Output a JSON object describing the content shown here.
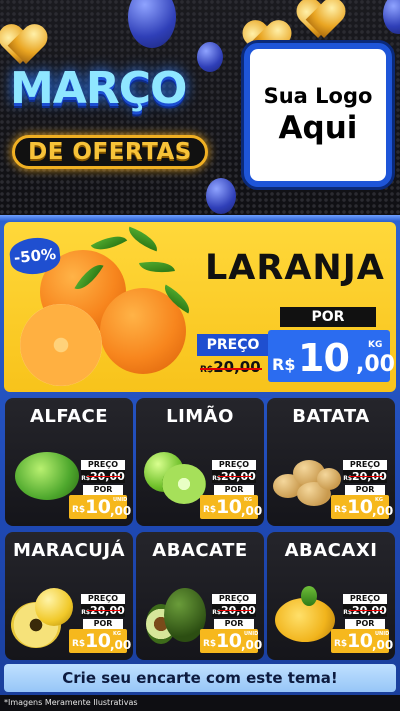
{
  "header": {
    "title_line1": "MARÇO",
    "title_line2": "DE OFERTAS",
    "logo_line1": "Sua Logo",
    "logo_line2": "Aqui"
  },
  "featured": {
    "discount": "-50%",
    "name": "LARANJA",
    "por_label": "POR",
    "preco_label": "PREÇO",
    "old_currency": "R$",
    "old_price": "20,00",
    "currency": "R$",
    "price_int": "10",
    "price_dec": ",00",
    "unit": "KG"
  },
  "products": [
    {
      "name": "ALFACE",
      "preco_label": "PREÇO",
      "old_currency": "R$",
      "old_price": "20,00",
      "por_label": "POR",
      "currency": "R$",
      "price_int": "10",
      "price_dec": ",00",
      "unit": "UNID"
    },
    {
      "name": "LIMÃO",
      "preco_label": "PREÇO",
      "old_currency": "R$",
      "old_price": "20,00",
      "por_label": "POR",
      "currency": "R$",
      "price_int": "10",
      "price_dec": ",00",
      "unit": "KG"
    },
    {
      "name": "BATATA",
      "preco_label": "PREÇO",
      "old_currency": "R$",
      "old_price": "20,00",
      "por_label": "POR",
      "currency": "R$",
      "price_int": "10",
      "price_dec": ",00",
      "unit": "KG"
    },
    {
      "name": "MARACUJÁ",
      "preco_label": "PREÇO",
      "old_currency": "R$",
      "old_price": "20,00",
      "por_label": "POR",
      "currency": "R$",
      "price_int": "10",
      "price_dec": ",00",
      "unit": "KG"
    },
    {
      "name": "ABACATE",
      "preco_label": "PREÇO",
      "old_currency": "R$",
      "old_price": "20,00",
      "por_label": "POR",
      "currency": "R$",
      "price_int": "10",
      "price_dec": ",00",
      "unit": "UNID"
    },
    {
      "name": "ABACAXI",
      "preco_label": "PREÇO",
      "old_currency": "R$",
      "old_price": "20,00",
      "por_label": "POR",
      "currency": "R$",
      "price_int": "10",
      "price_dec": ",00",
      "unit": "UNID"
    }
  ],
  "footer": {
    "cta": "Crie seu encarte com este tema!",
    "disclaimer": "*Imagens Meramente Ilustrativas"
  },
  "colors": {
    "accent_blue": "#1f4fd0",
    "accent_yellow": "#f8c31b",
    "card_bg": "#1c1c21"
  }
}
